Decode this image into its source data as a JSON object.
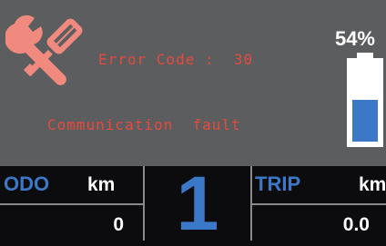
{
  "error": {
    "code_text": "Error Code :  30",
    "message_text": "Communication  fault",
    "icon": "wrench-screwdriver-icon"
  },
  "battery": {
    "percent_text": "54%",
    "level": 0.54,
    "fill_color": "#3c78c8"
  },
  "odo": {
    "label": "ODO",
    "unit": "km",
    "value": "0"
  },
  "assist": {
    "level": "1"
  },
  "trip": {
    "label": "TRIP",
    "unit": "km",
    "value": "0.0"
  },
  "colors": {
    "panel": "#5c5d5f",
    "error_text": "#e64a3f",
    "accent": "#3c78c8"
  }
}
